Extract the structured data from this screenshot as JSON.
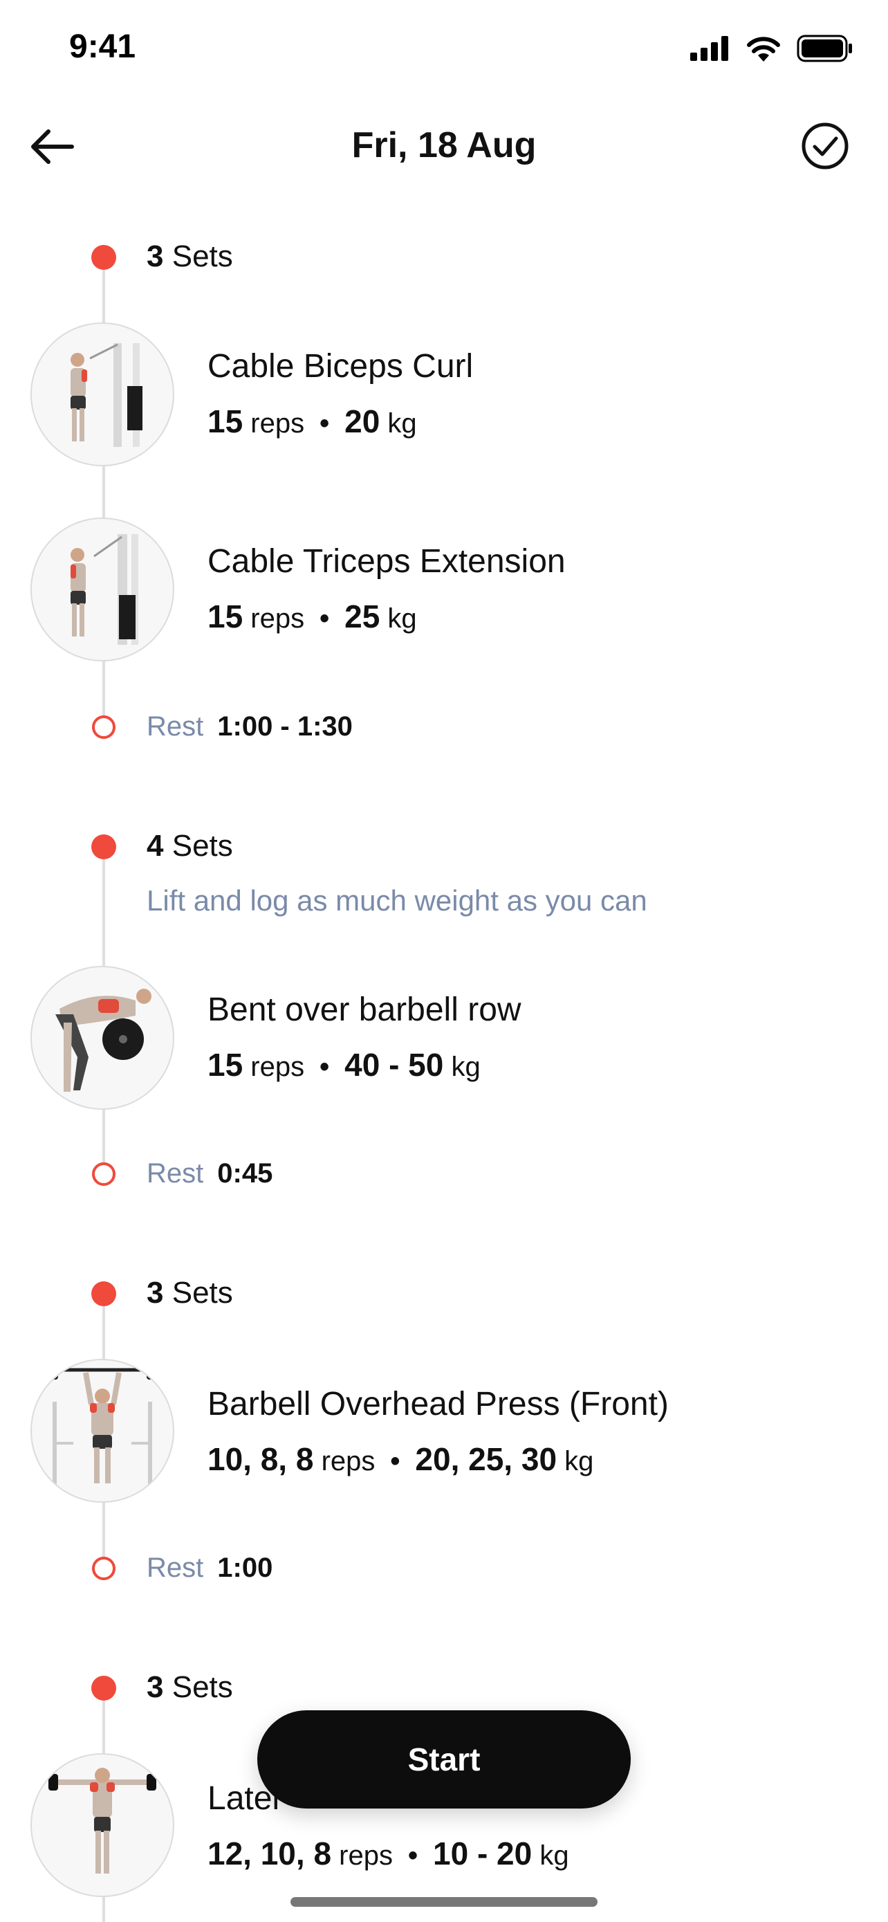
{
  "status_bar": {
    "time": "9:41"
  },
  "header": {
    "title": "Fri, 18 Aug",
    "back_icon": "arrow-left-icon",
    "done_icon": "check-circle-icon"
  },
  "colors": {
    "accent": "#ef4a3c",
    "muted": "#7a8aa8",
    "button": "#0d0d0d",
    "line": "#dedede"
  },
  "groups": [
    {
      "sets_count": "3",
      "sets_word": "Sets",
      "exercises": [
        {
          "name": "Cable Biceps Curl",
          "reps": "15",
          "reps_unit": "reps",
          "weight": "20",
          "weight_unit": "kg"
        },
        {
          "name": "Cable Triceps Extension",
          "reps": "15",
          "reps_unit": "reps",
          "weight": "25",
          "weight_unit": "kg"
        }
      ],
      "rest": {
        "label": "Rest",
        "value": "1:00 - 1:30"
      }
    },
    {
      "sets_count": "4",
      "sets_word": "Sets",
      "note": "Lift and log as much weight as you can",
      "exercises": [
        {
          "name": "Bent over barbell row",
          "reps": "15",
          "reps_unit": "reps",
          "weight": "40 - 50",
          "weight_unit": "kg"
        }
      ],
      "rest": {
        "label": "Rest",
        "value": "0:45"
      }
    },
    {
      "sets_count": "3",
      "sets_word": "Sets",
      "exercises": [
        {
          "name": "Barbell Overhead Press (Front)",
          "reps": "10, 8, 8",
          "reps_unit": "reps",
          "weight": "20, 25, 30",
          "weight_unit": "kg"
        }
      ],
      "rest": {
        "label": "Rest",
        "value": "1:00"
      }
    },
    {
      "sets_count": "3",
      "sets_word": "Sets",
      "exercises": [
        {
          "name": "Later",
          "reps": "12, 10, 8",
          "reps_unit": "reps",
          "weight": "10 - 20",
          "weight_unit": "kg"
        }
      ]
    }
  ],
  "start_button": {
    "label": "Start"
  }
}
